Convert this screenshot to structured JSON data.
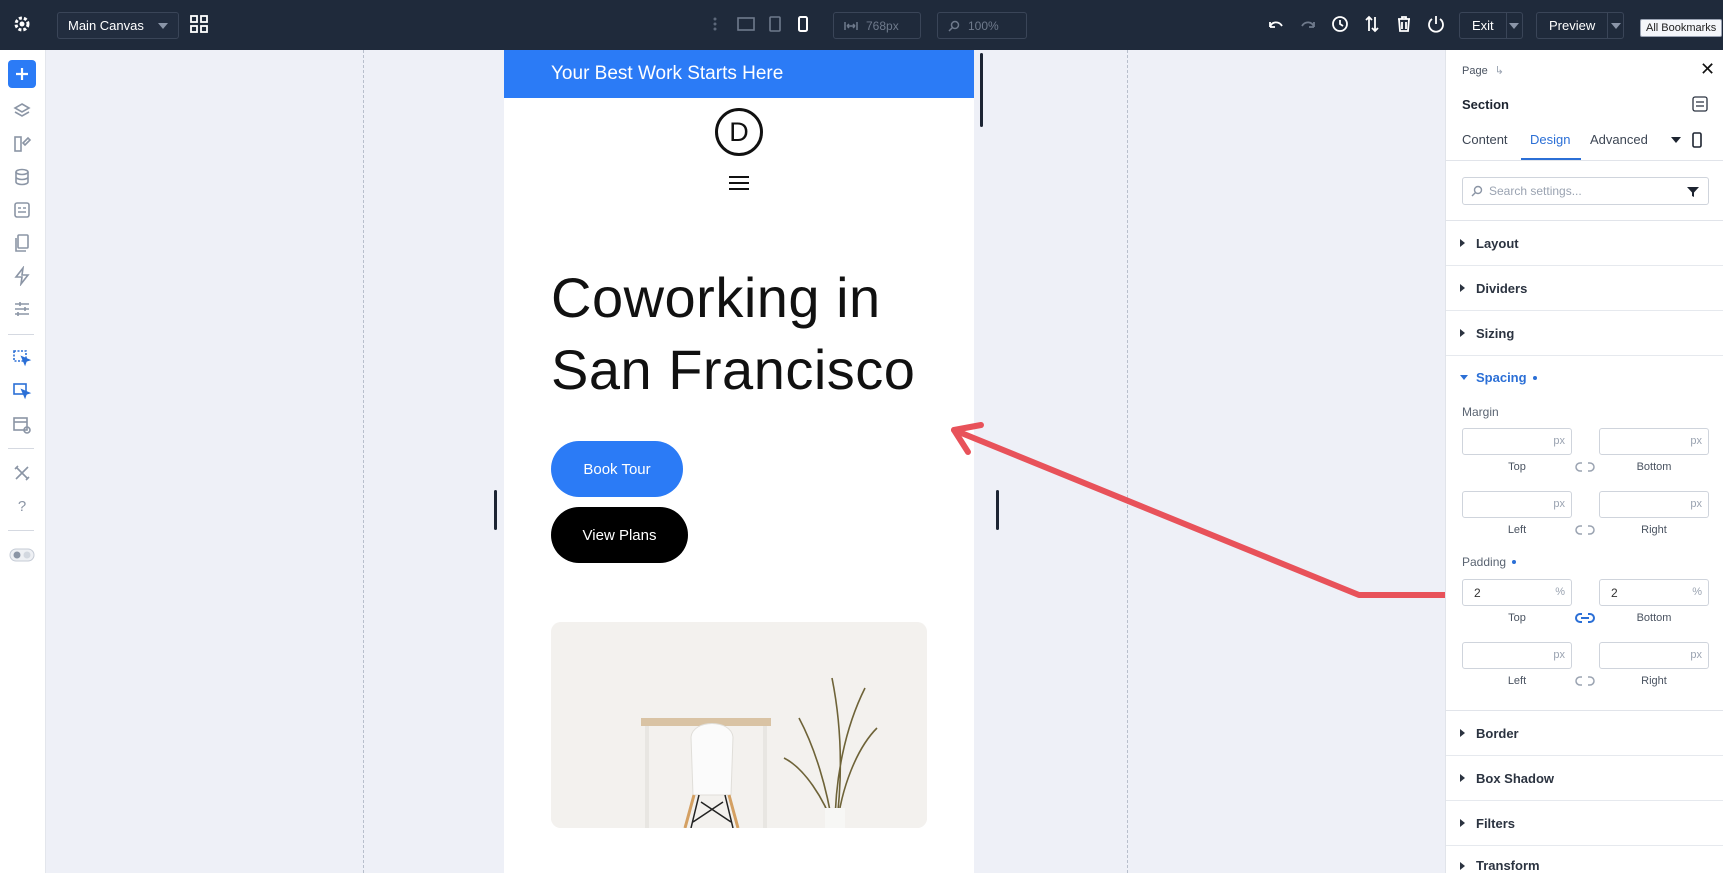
{
  "topbar": {
    "canvas_name": "Main Canvas",
    "width_value": "768px",
    "zoom_value": "100%",
    "exit_label": "Exit",
    "preview_label": "Preview",
    "bookmarks_tooltip": "All Bookmarks"
  },
  "preview": {
    "banner_text": "Your Best Work Starts Here",
    "logo_letter": "D",
    "hero_line1": "Coworking in",
    "hero_line2": "San Francisco",
    "primary_button": "Book Tour",
    "secondary_button": "View Plans"
  },
  "panel": {
    "breadcrumb": "Page",
    "element_title": "Section",
    "tabs": [
      "Content",
      "Design",
      "Advanced"
    ],
    "active_tab": "Design",
    "search_placeholder": "Search settings...",
    "groups_top": [
      "Layout",
      "Dividers",
      "Sizing"
    ],
    "spacing_title": "Spacing",
    "margin_label": "Margin",
    "padding_label": "Padding",
    "margin": {
      "top": "",
      "bottom": "",
      "left": "",
      "right": "",
      "unit": "px"
    },
    "padding": {
      "top": "2",
      "bottom": "2",
      "top_unit": "%",
      "bottom_unit": "%",
      "left": "",
      "right": "",
      "unit": "px"
    },
    "labels": {
      "top": "Top",
      "bottom": "Bottom",
      "left": "Left",
      "right": "Right"
    },
    "groups_bottom": [
      "Border",
      "Box Shadow",
      "Filters",
      "Transform"
    ]
  },
  "colors": {
    "topbar_bg": "#1f2a3b",
    "accent": "#2b7bf6",
    "annotation_arrow": "#e8525a"
  }
}
